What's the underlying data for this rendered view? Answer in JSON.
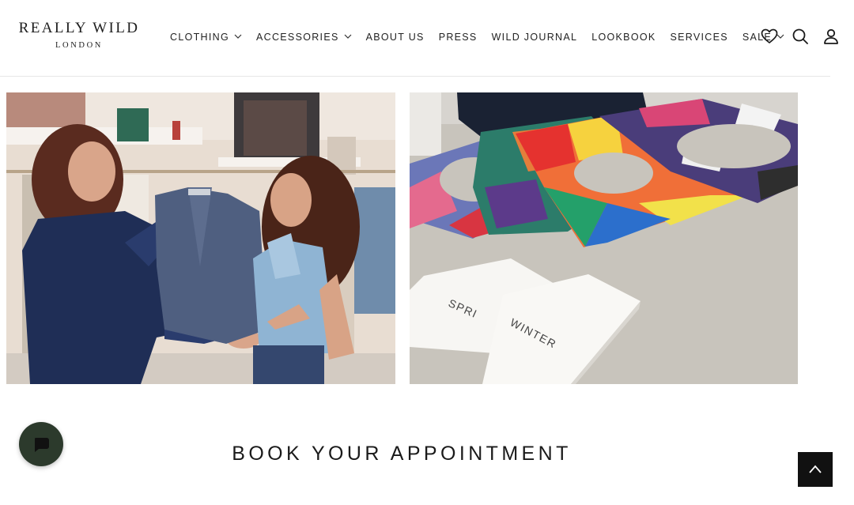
{
  "logo": {
    "brand": "REALLY WILD",
    "city": "LONDON"
  },
  "nav": {
    "items": [
      {
        "label": "CLOTHING",
        "has_dropdown": true
      },
      {
        "label": "ACCESSORIES",
        "has_dropdown": true
      },
      {
        "label": "ABOUT US",
        "has_dropdown": false
      },
      {
        "label": "PRESS",
        "has_dropdown": false
      },
      {
        "label": "WILD JOURNAL",
        "has_dropdown": false
      },
      {
        "label": "LOOKBOOK",
        "has_dropdown": false
      },
      {
        "label": "SERVICES",
        "has_dropdown": false
      },
      {
        "label": "SALE",
        "has_dropdown": true
      }
    ]
  },
  "header_icons": [
    "heart-icon",
    "search-icon",
    "account-icon"
  ],
  "images": {
    "left": "styling-consultation-photo",
    "right": "colour-analysis-photo",
    "right_booklet_text_1": "SPRI",
    "right_booklet_text_2": "WINTER"
  },
  "section": {
    "title": "BOOK YOUR APPOINTMENT"
  },
  "floating": {
    "chat_icon": "chat-bubble-icon",
    "top_icon": "chevron-up-icon"
  },
  "colors": {
    "accent_dark_green": "#2c3a2c",
    "top_button": "#111111",
    "text": "#1a1a1a",
    "divider": "#e6e6e6"
  }
}
